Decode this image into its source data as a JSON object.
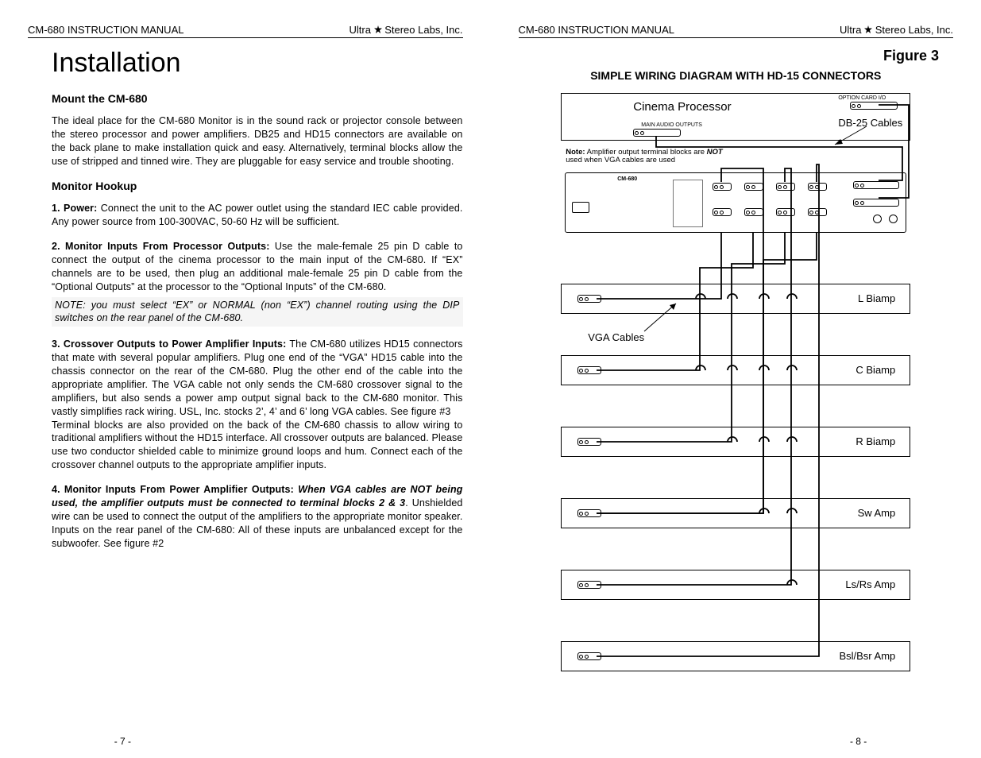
{
  "header": {
    "manual": "CM-680 INSTRUCTION MANUAL",
    "company_pre": "Ultra",
    "company_post": "Stereo Labs, Inc."
  },
  "left": {
    "title": "Installation",
    "h_mount": "Mount the CM-680",
    "p_mount": "The ideal place for the CM-680 Monitor is in the sound rack or projector console between the stereo processor and power amplifiers. DB25 and HD15 connectors are available on the back plane to make installation quick and easy. Alternatively, terminal blocks allow the use of stripped and tinned wire. They are pluggable for easy service and trouble shooting.",
    "h_hookup": "Monitor Hookup",
    "s1b": "1. Power:",
    "s1": " Connect the unit to the AC power outlet using the standard IEC cable provided. Any power source from 100-300VAC, 50-60 Hz will be sufficient.",
    "s2b": "2. Monitor Inputs From Processor Outputs:",
    "s2": " Use the male-female 25 pin D cable to connect the output of the cinema processor to the main input of the CM-680. If “EX” channels are to be used, then plug an additional male-female 25 pin D cable from the “Optional Outputs” at the processor to the “Optional Inputs” of the CM-680.",
    "note": "NOTE: you must select “EX” or NORMAL (non “EX”) channel routing using the DIP switches on the rear panel of the CM-680.",
    "s3b": "3. Crossover Outputs to Power Amplifier Inputs:",
    "s3a": " The CM-680 utilizes HD15 connectors that mate with several popular amplifiers. Plug one end of the “VGA” HD15 cable into the chassis connector on the rear of the CM-680. Plug the other end of the cable into the appropriate amplifier. The VGA cable not only sends the CM-680 crossover signal to the amplifiers, but also sends a power amp output signal back to the CM-680 monitor. This vastly simplifies rack wiring. USL, Inc. stocks 2’, 4’ and 6’ long VGA cables. See figure #3",
    "s3c": "Terminal blocks are also provided on the back of the CM-680 chassis to allow wiring to traditional amplifiers without the HD15 interface. All crossover outputs are balanced. Please use two conductor shielded cable to minimize ground loops and hum. Connect each of the crossover channel outputs to the appropriate amplifier inputs.",
    "s4b": "4. Monitor Inputs From Power Amplifier Outputs:",
    "s4i": " When VGA cables are NOT being used, the amplifier outputs must be connected to terminal blocks 2 & 3",
    "s4": ". Unshielded wire can be used to connect the output of the amplifiers to the appropriate monitor speaker. Inputs on the rear panel of the CM-680: All of these inputs are unbalanced except for the subwoofer. See figure #2",
    "pgno": "- 7 -"
  },
  "right": {
    "fig": "Figure 3",
    "figtitle": "SIMPLE WIRING DIAGRAM WITH HD-15 CONNECTORS",
    "cp": "Cinema Processor",
    "db25": "DB-25 Cables",
    "noteb": "Note:",
    "note": " Amplifier output terminal blocks are ",
    "noteb2": "NOT",
    "note2": " used when VGA cables are used",
    "vga": "VGA Cables",
    "amps": [
      "L Biamp",
      "C Biamp",
      "R Biamp",
      "Sw Amp",
      "Ls/Rs Amp",
      "Bsl/Bsr Amp"
    ],
    "cm": "CM-680",
    "mao": "MAIN AUDIO OUTPUTS",
    "oio": "OPTION CARD I/O",
    "pgno": "- 8 -"
  }
}
